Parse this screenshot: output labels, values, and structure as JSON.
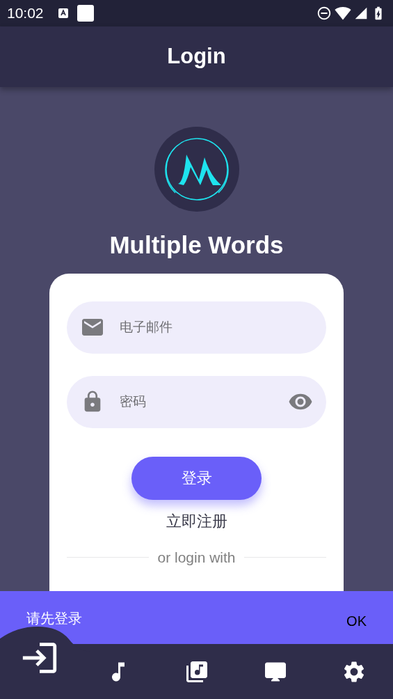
{
  "status_bar": {
    "time": "10:02"
  },
  "app_bar": {
    "title": "Login"
  },
  "app_name": "Multiple Words",
  "login_form": {
    "email": {
      "placeholder": "电子邮件"
    },
    "password": {
      "placeholder": "密码"
    },
    "submit": "登录",
    "register": "立即注册",
    "divider": "or login with"
  },
  "snackbar": {
    "message": "请先登录",
    "action": "OK"
  },
  "bottom_nav": [
    {
      "kind": "login",
      "selected": true
    },
    {
      "kind": "music",
      "selected": false
    },
    {
      "kind": "library",
      "selected": false
    },
    {
      "kind": "desktop",
      "selected": false
    },
    {
      "kind": "settings",
      "selected": false
    }
  ]
}
